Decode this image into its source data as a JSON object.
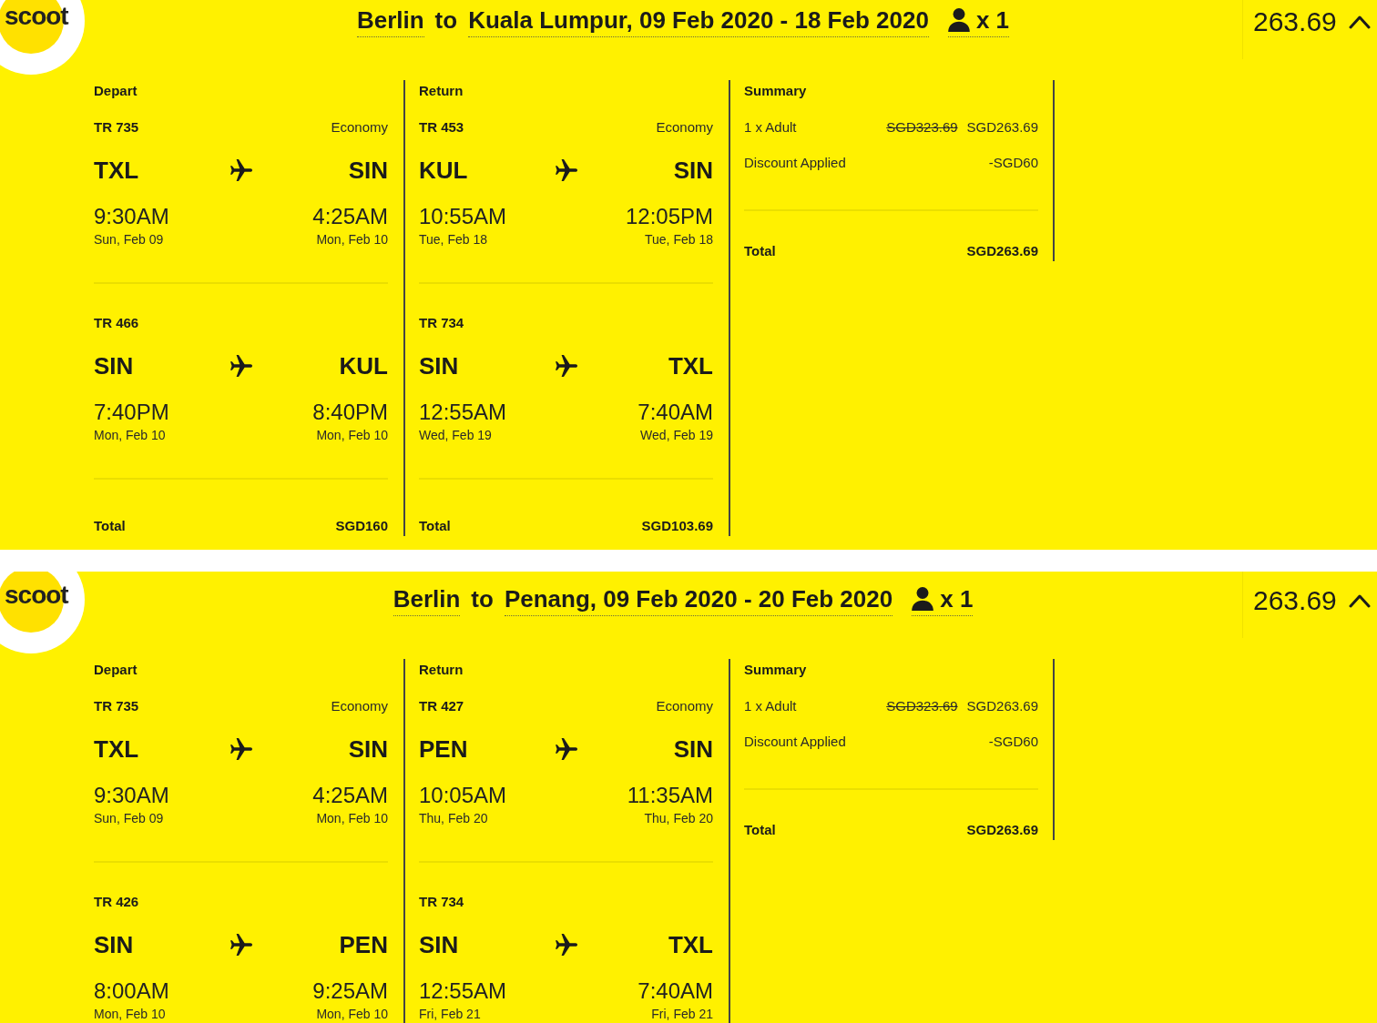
{
  "bookings": [
    {
      "logo": "scoot",
      "route": {
        "origin": "Berlin",
        "connector": "to",
        "destination": "Kuala Lumpur, 09 Feb 2020 - 18 Feb 2020",
        "passengers": "x 1"
      },
      "price": "263.69",
      "expanded": true,
      "journeys": [
        {
          "heading": "Depart",
          "segments": [
            {
              "flight": "TR 735",
              "cabin": "Economy",
              "from": {
                "code": "TXL",
                "time": "9:30AM",
                "date": "Sun, Feb 09"
              },
              "to": {
                "code": "SIN",
                "time": "4:25AM",
                "date": "Mon, Feb 10"
              }
            },
            {
              "flight": "TR 466",
              "from": {
                "code": "SIN",
                "time": "7:40PM",
                "date": "Mon, Feb 10"
              },
              "to": {
                "code": "KUL",
                "time": "8:40PM",
                "date": "Mon, Feb 10"
              }
            }
          ],
          "total": {
            "label": "Total",
            "amount": "SGD160"
          }
        },
        {
          "heading": "Return",
          "segments": [
            {
              "flight": "TR 453",
              "cabin": "Economy",
              "from": {
                "code": "KUL",
                "time": "10:55AM",
                "date": "Tue, Feb 18"
              },
              "to": {
                "code": "SIN",
                "time": "12:05PM",
                "date": "Tue, Feb 18"
              }
            },
            {
              "flight": "TR 734",
              "from": {
                "code": "SIN",
                "time": "12:55AM",
                "date": "Wed, Feb 19"
              },
              "to": {
                "code": "TXL",
                "time": "7:40AM",
                "date": "Wed, Feb 19"
              }
            }
          ],
          "total": {
            "label": "Total",
            "amount": "SGD103.69"
          }
        }
      ],
      "summary": {
        "heading": "Summary",
        "lines": [
          {
            "label": "1 x Adult",
            "old_price": "SGD323.69",
            "price": "SGD263.69"
          },
          {
            "label": "Discount Applied",
            "price": "-SGD60"
          }
        ],
        "total": {
          "label": "Total",
          "amount": "SGD263.69"
        }
      }
    },
    {
      "logo": "scoot",
      "route": {
        "origin": "Berlin",
        "connector": "to",
        "destination": "Penang, 09 Feb 2020 - 20 Feb 2020",
        "passengers": "x 1"
      },
      "price": "263.69",
      "expanded": true,
      "journeys": [
        {
          "heading": "Depart",
          "segments": [
            {
              "flight": "TR 735",
              "cabin": "Economy",
              "from": {
                "code": "TXL",
                "time": "9:30AM",
                "date": "Sun, Feb 09"
              },
              "to": {
                "code": "SIN",
                "time": "4:25AM",
                "date": "Mon, Feb 10"
              }
            },
            {
              "flight": "TR 426",
              "from": {
                "code": "SIN",
                "time": "8:00AM",
                "date": "Mon, Feb 10"
              },
              "to": {
                "code": "PEN",
                "time": "9:25AM",
                "date": "Mon, Feb 10"
              }
            }
          ]
        },
        {
          "heading": "Return",
          "segments": [
            {
              "flight": "TR 427",
              "cabin": "Economy",
              "from": {
                "code": "PEN",
                "time": "10:05AM",
                "date": "Thu, Feb 20"
              },
              "to": {
                "code": "SIN",
                "time": "11:35AM",
                "date": "Thu, Feb 20"
              }
            },
            {
              "flight": "TR 734",
              "from": {
                "code": "SIN",
                "time": "12:55AM",
                "date": "Fri, Feb 21"
              },
              "to": {
                "code": "TXL",
                "time": "7:40AM",
                "date": "Fri, Feb 21"
              }
            }
          ]
        }
      ],
      "summary": {
        "heading": "Summary",
        "lines": [
          {
            "label": "1 x Adult",
            "old_price": "SGD323.69",
            "price": "SGD263.69"
          },
          {
            "label": "Discount Applied",
            "price": "-SGD60"
          }
        ],
        "total": {
          "label": "Total",
          "amount": "SGD263.69"
        }
      }
    }
  ]
}
